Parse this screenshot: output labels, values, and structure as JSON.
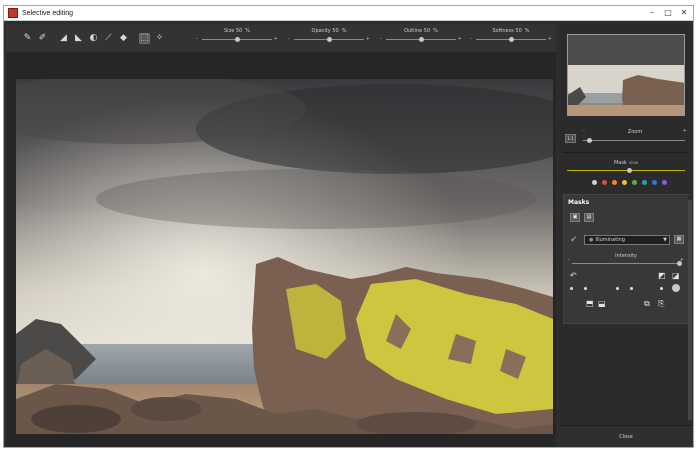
{
  "window": {
    "title": "Selective editing",
    "minimize": "–",
    "maximize": "□",
    "close": "✕"
  },
  "toolbar": {
    "tools": [
      {
        "name": "brush-icon",
        "glyph": "✎"
      },
      {
        "name": "auto-brush-icon",
        "glyph": "✐"
      },
      {
        "name": "eraser-icon",
        "glyph": "◢"
      },
      {
        "name": "auto-eraser-icon",
        "glyph": "◣"
      },
      {
        "name": "gradient-icon",
        "glyph": "◐"
      },
      {
        "name": "pipette-icon",
        "glyph": "⟋"
      },
      {
        "name": "fill-icon",
        "glyph": "◆"
      },
      {
        "name": "select-icon",
        "glyph": "⬚"
      },
      {
        "name": "magic-wand-icon",
        "glyph": "✧"
      }
    ],
    "sliders": [
      {
        "label": "Size",
        "value": "50",
        "unit": "%",
        "level": 0.5
      },
      {
        "label": "Opacity",
        "value": "50",
        "unit": "%",
        "level": 0.5
      },
      {
        "label": "Outline",
        "value": "50",
        "unit": "%",
        "level": 0.5
      },
      {
        "label": "Softness",
        "value": "50",
        "unit": "%",
        "level": 0.5
      }
    ]
  },
  "navigator": {
    "fit_label": "1:1",
    "zoom_label": "Zoom",
    "minus": "-",
    "plus": "+"
  },
  "mask_view": {
    "label": "Mask",
    "sub_label": "view",
    "colors": [
      "#cfcfcf",
      "#e04b3a",
      "#f08a24",
      "#e6c229",
      "#55b04a",
      "#33a0a0",
      "#3d6ed8",
      "#8a5ad8"
    ]
  },
  "masks": {
    "title": "Masks",
    "layer_name": "Illuminating",
    "intensity_label": "Intensity",
    "intensity_level": 1.0,
    "minus": "-",
    "plus": "+"
  },
  "footer": {
    "close_label": "Close"
  }
}
